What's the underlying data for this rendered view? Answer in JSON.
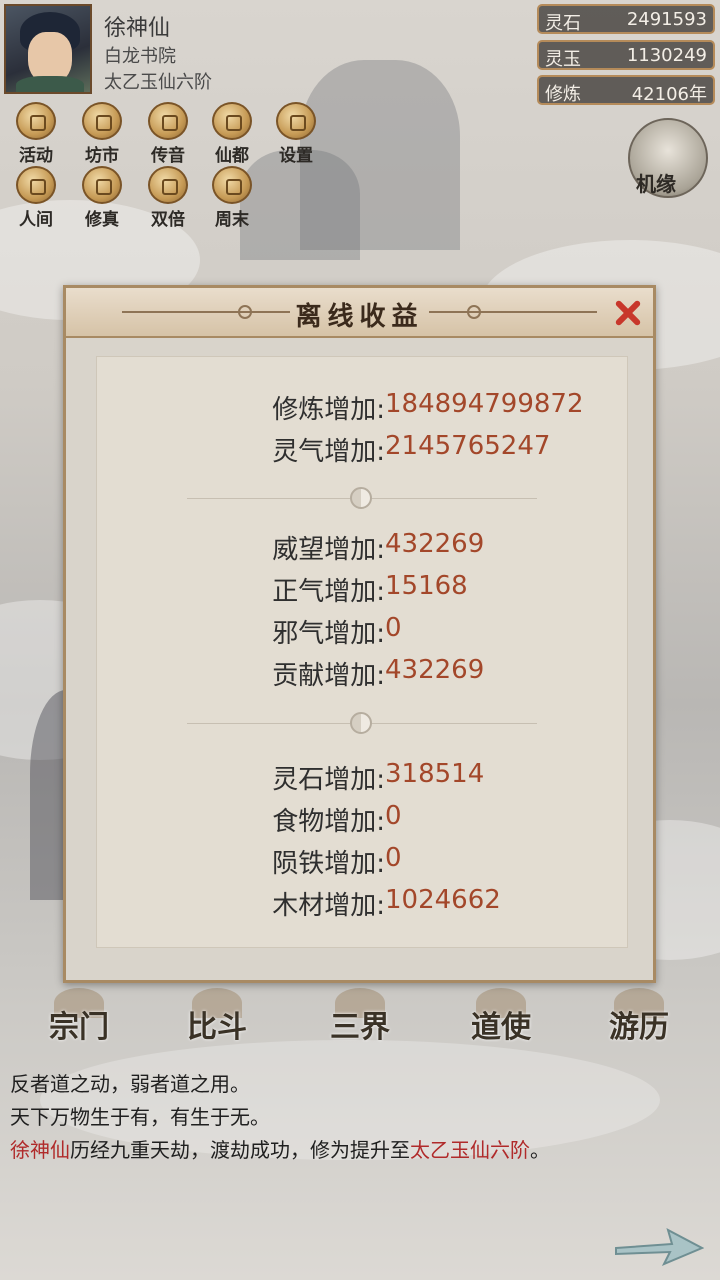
{
  "player": {
    "name": "徐神仙",
    "sect": "白龙书院",
    "realm": "太乙玉仙六阶"
  },
  "resources": [
    {
      "label": "灵石",
      "value": "2491593"
    },
    {
      "label": "灵玉",
      "value": "1130249"
    },
    {
      "label": "修炼",
      "value": "42106年"
    }
  ],
  "top_menu": {
    "row1": [
      "活动",
      "坊市",
      "传音",
      "仙都",
      "设置"
    ],
    "row2": [
      "人间",
      "修真",
      "双倍",
      "周末"
    ]
  },
  "jiyuan_label": "机缘",
  "dialog": {
    "title": "离线收益",
    "group1": [
      {
        "label": "修炼增加:",
        "value": "184894799872"
      },
      {
        "label": "灵气增加:",
        "value": "2145765247"
      }
    ],
    "group2": [
      {
        "label": "威望增加:",
        "value": "432269"
      },
      {
        "label": "正气增加:",
        "value": "15168"
      },
      {
        "label": "邪气增加:",
        "value": "0"
      },
      {
        "label": "贡献增加:",
        "value": "432269"
      }
    ],
    "group3": [
      {
        "label": "灵石增加:",
        "value": "318514"
      },
      {
        "label": "食物增加:",
        "value": "0"
      },
      {
        "label": "陨铁增加:",
        "value": "0"
      },
      {
        "label": "木材增加:",
        "value": "1024662"
      }
    ]
  },
  "bottom_nav": [
    "宗门",
    "比斗",
    "三界",
    "道使",
    "游历"
  ],
  "log": {
    "line1": "反者道之动，弱者道之用。",
    "line2": "天下万物生于有，有生于无。",
    "line3": {
      "name": "徐神仙",
      "middle": "历经九重天劫，渡劫成功，修为提升至",
      "realm": "太乙玉仙六阶",
      "end": "。"
    }
  },
  "colors": {
    "value_text": "#a3472a",
    "highlight": "#b02a2a",
    "close": "#c8372b"
  }
}
